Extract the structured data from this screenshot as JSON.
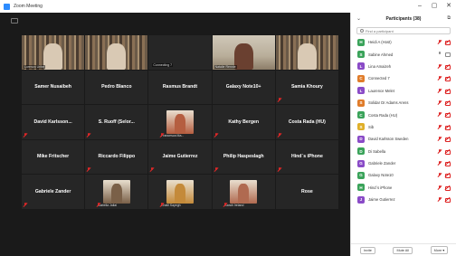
{
  "window": {
    "title": "Zoom Meeting",
    "controls": [
      "–",
      "▢",
      "✕"
    ]
  },
  "grid": {
    "tiles": [
      {
        "type": "video",
        "label": "Lorenzo Uribe",
        "scene": "shelf"
      },
      {
        "type": "video",
        "label": "",
        "scene": "shelf2"
      },
      {
        "type": "video-off",
        "label": "Connecting 7"
      },
      {
        "type": "video",
        "label": "Natalie Rennie",
        "scene": "room"
      },
      {
        "type": "video",
        "label": "",
        "scene": "shelf3"
      },
      {
        "type": "name",
        "name": "Samer Nusaibeh",
        "muted": false
      },
      {
        "type": "name",
        "name": "Pedro Blanco",
        "muted": false
      },
      {
        "type": "name",
        "name": "Rasmus Brandt",
        "muted": false
      },
      {
        "type": "name",
        "name": "Galaxy Note10+",
        "muted": false
      },
      {
        "type": "name",
        "name": "Samia Khoury",
        "muted": true
      },
      {
        "type": "name",
        "name": "David Karlsson...",
        "muted": true
      },
      {
        "type": "name",
        "name": "S. Ruoff (Selor...",
        "muted": true
      },
      {
        "type": "portrait",
        "label": "Francesca Ma...",
        "color": "#b55e40"
      },
      {
        "type": "name",
        "name": "Kathy Bergen",
        "muted": true
      },
      {
        "type": "name",
        "name": "Costa Rada (HU)",
        "muted": true
      },
      {
        "type": "name",
        "name": "Mike Fritscher",
        "muted": false
      },
      {
        "type": "name",
        "name": "Riccardo Filippo",
        "muted": true
      },
      {
        "type": "name",
        "name": "Jaime Gutierrez",
        "muted": true
      },
      {
        "type": "name",
        "name": "Philip Haspeslagh",
        "muted": true
      },
      {
        "type": "name",
        "name": "Hind´s iPhone",
        "muted": true
      },
      {
        "type": "name",
        "name": "Gabriele Zander",
        "muted": true
      },
      {
        "type": "portrait",
        "label": "Isabella Jallal",
        "color": "#7a6048"
      },
      {
        "type": "portrait",
        "label": "Khalil Sayegh",
        "color": "#c48a3a"
      },
      {
        "type": "portrait",
        "label": "Sarah Ireland",
        "color": "#b06a50"
      },
      {
        "type": "name",
        "name": "Rose",
        "muted": false
      }
    ]
  },
  "panel": {
    "title": "Participants (38)",
    "search_placeholder": "Find a participant",
    "participants": [
      {
        "initial": "H",
        "name": "Heidi A (Host)",
        "color": "#3aa35a",
        "mic": "off",
        "cam": "off"
      },
      {
        "initial": "S",
        "name": "Sabine Ahmed",
        "color": "#3aa35a",
        "mic": "on",
        "cam": "on"
      },
      {
        "initial": "L",
        "name": "Lina Amaizeh",
        "color": "#8a4bc7",
        "mic": "off",
        "cam": "off"
      },
      {
        "initial": "C",
        "name": "Connected 7",
        "color": "#e07c2a",
        "mic": "off",
        "cam": "off"
      },
      {
        "initial": "L",
        "name": "Laurence Melet",
        "color": "#8a4bc7",
        "mic": "off",
        "cam": "off"
      },
      {
        "initial": "S",
        "name": "Solidar Dr Adams Arens",
        "color": "#e07c2a",
        "mic": "off",
        "cam": "off"
      },
      {
        "initial": "C",
        "name": "Costa Rada (HU)",
        "color": "#3aa35a",
        "mic": "off",
        "cam": "off"
      },
      {
        "initial": "S",
        "name": "Sib",
        "color": "#e0b02a",
        "mic": "off",
        "cam": "off"
      },
      {
        "initial": "D",
        "name": "David Karlsson Sweden",
        "color": "#8a4bc7",
        "mic": "off",
        "cam": "off"
      },
      {
        "initial": "D",
        "name": "Di Sabella",
        "color": "#3aa35a",
        "mic": "off",
        "cam": "off"
      },
      {
        "initial": "G",
        "name": "Gabriele Zander",
        "color": "#8a4bc7",
        "mic": "off",
        "cam": "off"
      },
      {
        "initial": "G",
        "name": "Galaxy Note10",
        "color": "#3aa35a",
        "mic": "off",
        "cam": "off"
      },
      {
        "initial": "H",
        "name": "Hind´s iPhone",
        "color": "#3aa35a",
        "mic": "off",
        "cam": "off"
      },
      {
        "initial": "J",
        "name": "Jaime Gutierrez",
        "color": "#8a4bc7",
        "mic": "off",
        "cam": "off"
      }
    ],
    "footer": {
      "invite": "Invite",
      "mute_all": "Mute All",
      "more": "More ▾"
    }
  }
}
